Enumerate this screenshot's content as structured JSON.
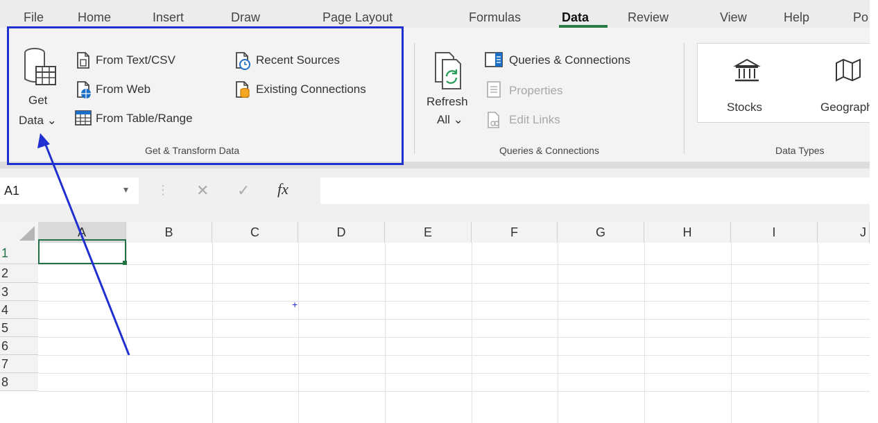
{
  "ribbon_tabs": [
    "File",
    "Home",
    "Insert",
    "Draw",
    "Page Layout",
    "Formulas",
    "Data",
    "Review",
    "View",
    "Help",
    "Po"
  ],
  "active_tab": "Data",
  "accent_color": "#217346",
  "highlight_color": "#1f2fd0",
  "groups": {
    "get_transform": {
      "label": "Get & Transform Data",
      "get_data_line1": "Get",
      "get_data_line2": "Data ⌄",
      "from_text_csv": "From Text/CSV",
      "from_web": "From Web",
      "from_table_range": "From Table/Range",
      "recent_sources": "Recent Sources",
      "existing_connections": "Existing Connections"
    },
    "queries": {
      "label": "Queries & Connections",
      "refresh_line1": "Refresh",
      "refresh_line2": "All ⌄",
      "queries_connections": "Queries & Connections",
      "properties": "Properties",
      "edit_links": "Edit Links"
    },
    "data_types": {
      "label": "Data Types",
      "stocks": "Stocks",
      "geography": "Geograph"
    }
  },
  "formula_bar": {
    "name_box": "A1",
    "dropdown": "▾",
    "dots": "⋮",
    "cancel": "✕",
    "enter": "✓",
    "fx": "fx",
    "value": ""
  },
  "sheet": {
    "columns": [
      "A",
      "B",
      "C",
      "D",
      "E",
      "F",
      "G",
      "H",
      "I",
      "J"
    ],
    "rows": [
      "1",
      "2",
      "3",
      "4",
      "5",
      "6",
      "7",
      "8"
    ],
    "active_cell": "A1",
    "cursor_mark": "+"
  },
  "annotation": {
    "arrow_color": "#1f2fd0"
  }
}
